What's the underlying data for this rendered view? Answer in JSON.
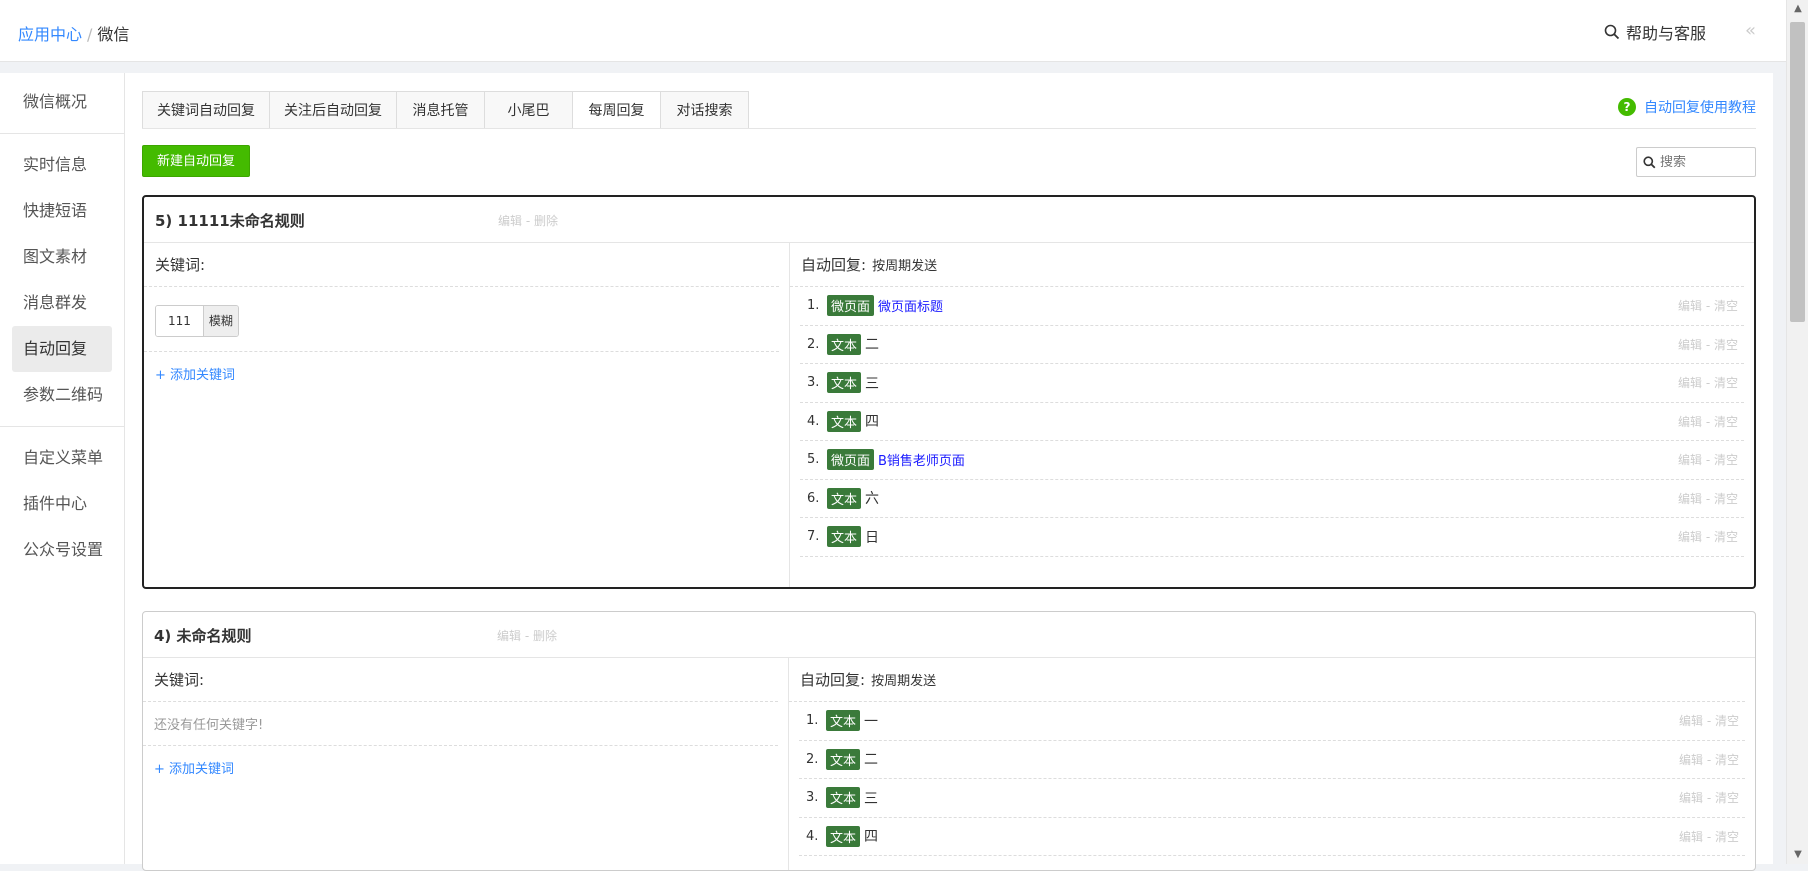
{
  "breadcrumb": {
    "parent": "应用中心",
    "separator": "/",
    "current": "微信"
  },
  "header": {
    "help_label": "帮助与客服",
    "collapse_glyph": "«"
  },
  "sidebar": {
    "groups": [
      [
        "微信概况"
      ],
      [
        "实时信息",
        "快捷短语",
        "图文素材",
        "消息群发",
        "自动回复",
        "参数二维码"
      ],
      [
        "自定义菜单",
        "插件中心",
        "公众号设置"
      ]
    ],
    "active": "自动回复"
  },
  "tabs": [
    "关键词自动回复",
    "关注后自动回复",
    "消息托管",
    "小尾巴",
    "每周回复",
    "对话搜索"
  ],
  "active_tab": "每周回复",
  "tutorial_label": "自动回复使用教程",
  "new_button_label": "新建自动回复",
  "search": {
    "placeholder": "搜索"
  },
  "rules": [
    {
      "title": "5) 11111未命名规则",
      "ops": "编辑 - 删除",
      "keyword_label": "关键词:",
      "keywords": [
        {
          "value": "111",
          "mode": "模糊"
        }
      ],
      "empty_text": "",
      "add_keyword": "+ 添加关键词",
      "reply_label": "自动回复:",
      "reply_mode": "按周期发送",
      "replies": [
        {
          "num": "1.",
          "type": "微页面",
          "content": "微页面标题",
          "is_link": true,
          "ops": "编辑 - 清空"
        },
        {
          "num": "2.",
          "type": "文本",
          "content": "二",
          "is_link": false,
          "ops": "编辑 - 清空"
        },
        {
          "num": "3.",
          "type": "文本",
          "content": "三",
          "is_link": false,
          "ops": "编辑 - 清空"
        },
        {
          "num": "4.",
          "type": "文本",
          "content": "四",
          "is_link": false,
          "ops": "编辑 - 清空"
        },
        {
          "num": "5.",
          "type": "微页面",
          "content": "B销售老师页面",
          "is_link": true,
          "ops": "编辑 - 清空"
        },
        {
          "num": "6.",
          "type": "文本",
          "content": "六",
          "is_link": false,
          "ops": "编辑 - 清空"
        },
        {
          "num": "7.",
          "type": "文本",
          "content": "日",
          "is_link": false,
          "ops": "编辑 - 清空"
        }
      ]
    },
    {
      "title": "4) 未命名规则",
      "ops": "编辑 - 删除",
      "keyword_label": "关键词:",
      "keywords": [],
      "empty_text": "还没有任何关键字!",
      "add_keyword": "+ 添加关键词",
      "reply_label": "自动回复:",
      "reply_mode": "按周期发送",
      "replies": [
        {
          "num": "1.",
          "type": "文本",
          "content": "一",
          "is_link": false,
          "ops": "编辑 - 清空"
        },
        {
          "num": "2.",
          "type": "文本",
          "content": "二",
          "is_link": false,
          "ops": "编辑 - 清空"
        },
        {
          "num": "3.",
          "type": "文本",
          "content": "三",
          "is_link": false,
          "ops": "编辑 - 清空"
        },
        {
          "num": "4.",
          "type": "文本",
          "content": "四",
          "is_link": false,
          "ops": "编辑 - 清空"
        }
      ]
    }
  ],
  "icons": {
    "help": "search-icon",
    "tutorial": "question-circle-icon",
    "search": "search-icon"
  },
  "colors": {
    "accent": "#3388ff",
    "primary_button": "#44bb00",
    "badge": "#3a7a3a"
  }
}
